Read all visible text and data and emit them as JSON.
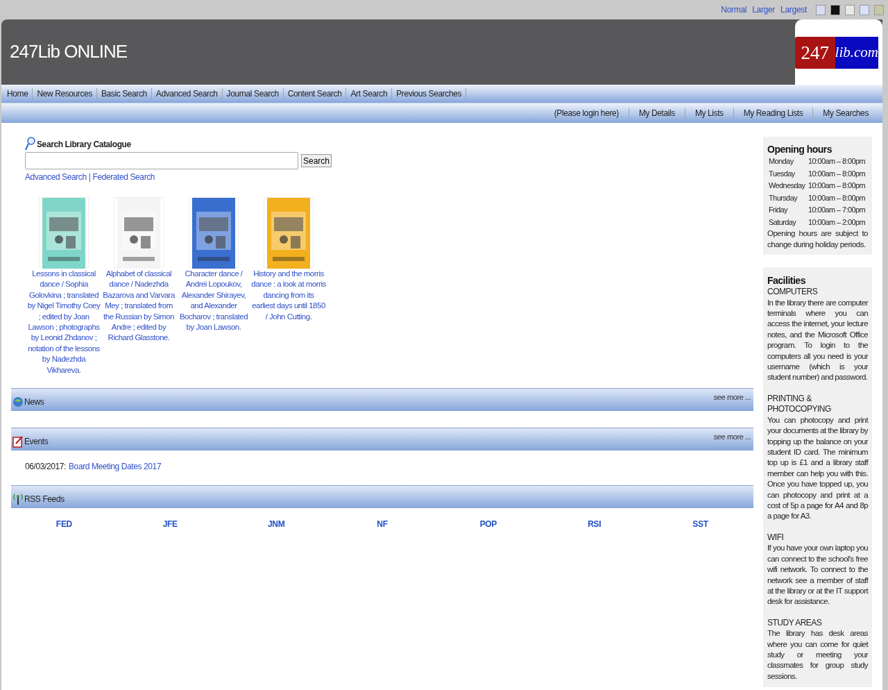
{
  "text_size_links": [
    "Normal",
    "Larger",
    "Largest"
  ],
  "theme_swatches": [
    {
      "color": "#d8dcf0"
    },
    {
      "color": "#111111"
    },
    {
      "color": "#e8e8e8"
    },
    {
      "color": "#d6e2f8"
    },
    {
      "color": "#c4c9a4"
    }
  ],
  "header": {
    "title": "247Lib ONLINE",
    "logo": [
      "247",
      "lib.com"
    ]
  },
  "nav": [
    "Home",
    "New Resources",
    "Basic Search",
    "Advanced Search",
    "Journal Search",
    "Content Search",
    "Art Search",
    "Previous Searches"
  ],
  "user_nav": [
    "(Please login here)",
    "My Details",
    "My Lists",
    "My Reading Lists",
    "My Searches"
  ],
  "search": {
    "title": "Search Library Catalogue",
    "button": "Search",
    "links": [
      "Advanced Search",
      "Federated Search"
    ],
    "separator": "|"
  },
  "books": [
    {
      "title": "Lessons in classical dance / Sophia Golovkina ; translated by Nigel Timothy Coey ; edited by Joan Lawson ; photographs by Leonid Zhdanov ; notation of the lessons by Nadezhda Vikhareva."
    },
    {
      "title": "Alphabet of classical dance / Nadezhda Bazarova and Varvara Mey ; translated from the Russian by Simon Andre ; edited by Richard Glasstone."
    },
    {
      "title": "Character dance / Andrei Lopoukov, Alexander Shirayev, and Alexander Bocharov ; translated by Joan Lawson."
    },
    {
      "title": "History and the morris dance : a look at morris dancing from its earliest days until 1850 / John Cutting."
    }
  ],
  "sections": [
    {
      "kind": "news",
      "title": "News",
      "see_more": "see more ..."
    },
    {
      "kind": "events",
      "title": "Events",
      "see_more": "see more ...",
      "items": [
        {
          "date": "06/03/2017:",
          "link": "Board Meeting Dates 2017"
        }
      ]
    },
    {
      "kind": "rss",
      "title": "RSS Feeds",
      "feeds": [
        "FED",
        "JFE",
        "JNM",
        "NF",
        "POP",
        "RSI",
        "SST"
      ]
    }
  ],
  "opening_hours": {
    "title": "Opening hours",
    "rows": [
      [
        "Monday",
        "10:00am – 8:00pm"
      ],
      [
        "Tuesday",
        "10:00am – 8:00pm"
      ],
      [
        "Wednesday",
        "10:00am – 8:00pm"
      ],
      [
        "Thursday",
        "10:00am – 8:00pm"
      ],
      [
        "Friday",
        "10:00am – 7:00pm"
      ],
      [
        "Saturday",
        "10:00am – 2:00pm"
      ]
    ],
    "note": "Opening hours are subject to change during holiday periods."
  },
  "facilities": {
    "title": "Facilities",
    "items": [
      {
        "heading": "COMPUTERS",
        "text": "In the library there are computer terminals where you can access the internet, your lecture notes, and the Microsoft Office program. To login to the computers all you need is your username (which is your student number) and password."
      },
      {
        "heading": "PRINTING & PHOTOCOPYING",
        "text": "You can photocopy and print your documents at the library by topping up the balance on your student ID card. The minimum top up is £1 and a library staff member can help you with this. Once you have topped up, you can photocopy and print at a cost of 5p a page for A4 and 8p a page for A3."
      },
      {
        "heading": "WIFI",
        "text": "If you have your own laptop you can connect to the school's free wifi network. To connect to the network see a member of staff at the library or at the IT support desk for assistance."
      },
      {
        "heading": "STUDY AREAS",
        "text": "The library has desk areas where you can come for quiet study or meeting your classmates for group study sessions."
      }
    ]
  }
}
